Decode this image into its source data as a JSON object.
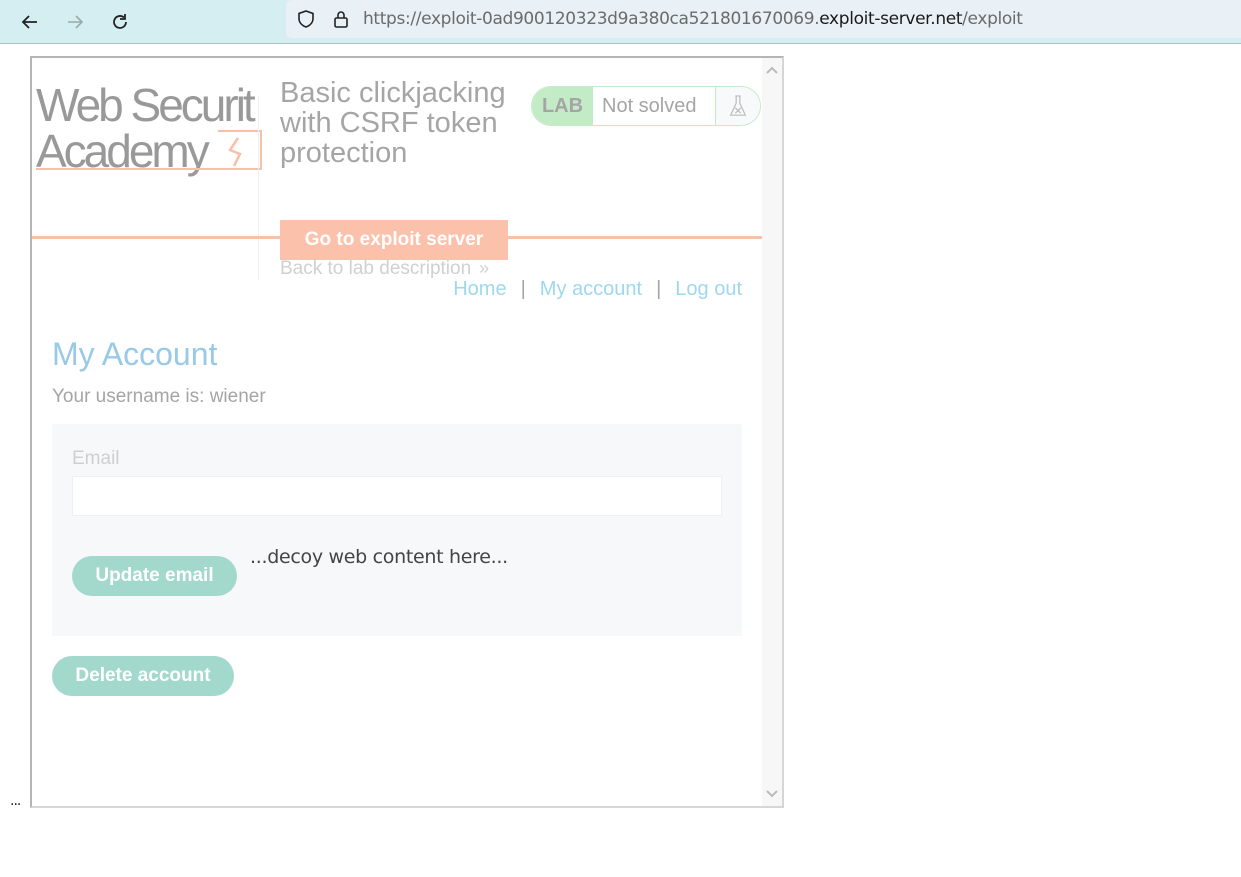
{
  "browser": {
    "url_prefix": "https://exploit-0ad900120323d9a380ca521801670069.",
    "url_domain": "exploit-server.net",
    "url_path": "/exploit",
    "icons": {
      "back": "arrow-left-icon",
      "forward": "arrow-right-icon",
      "reload": "reload-icon",
      "shield": "shield-icon",
      "lock": "lock-icon"
    }
  },
  "lab": {
    "logo_line1": "Web Securit",
    "logo_line2": "Academy",
    "title": "Basic clickjacking with CSRF token protection",
    "badge": "LAB",
    "status": "Not solved",
    "exploit_button": "Go to exploit server",
    "back_link": "Back to lab description",
    "back_chevron": "»"
  },
  "nav": {
    "home": "Home",
    "my_account": "My account",
    "log_out": "Log out",
    "separator": "|"
  },
  "account": {
    "heading": "My Account",
    "username_line": "Your username is: wiener",
    "email_label": "Email",
    "email_value": "",
    "update_button": "Update email",
    "delete_button": "Delete account"
  },
  "decoy_text": "...decoy web content here...",
  "trailing_text": "...",
  "colors": {
    "toolbar_bg": "#d4eef2",
    "orange_accent": "#f8bfa9",
    "lab_green": "#c3ecc6",
    "link_blue": "#9fd8ee",
    "heading_blue": "#98c9e7",
    "button_teal": "#a3d8cd"
  }
}
